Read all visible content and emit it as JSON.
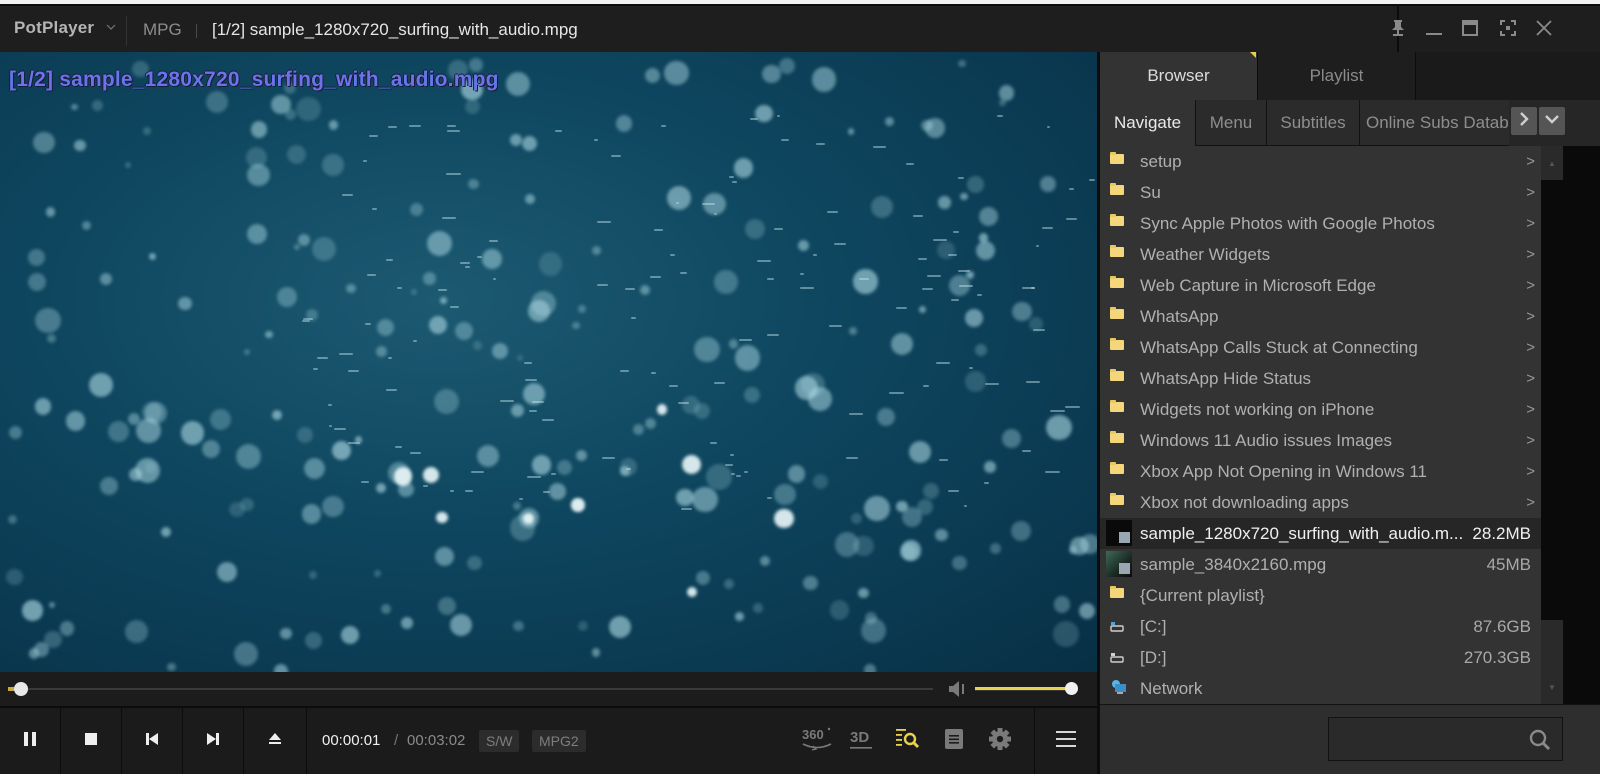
{
  "titlebar": {
    "app_name": "PotPlayer",
    "app_menu_chevron": "⌄",
    "format": "MPG",
    "title": "[1/2] sample_1280x720_surfing_with_audio.mpg",
    "window_buttons": [
      "pin-icon",
      "minimize-icon",
      "maximize-icon",
      "fullscreen-icon",
      "close-icon"
    ]
  },
  "video": {
    "osd_text": "[1/2] sample_1280x720_surfing_with_audio.mpg"
  },
  "playback": {
    "seek_progress_fraction": 0.005,
    "volume_fraction": 1.0,
    "current_time": "00:00:01",
    "time_separator": "/",
    "total_time": "00:03:02",
    "decoder_badge": "S/W",
    "codec_badge": "MPG2",
    "buttons": [
      "pause",
      "stop",
      "previous",
      "next",
      "eject"
    ],
    "right_icons": [
      "360-icon",
      "3d-icon",
      "playlist-search-icon",
      "document-icon",
      "gear-icon",
      "menu-icon"
    ],
    "label_360": "360°",
    "label_3d": "3D"
  },
  "panel": {
    "tabs": [
      {
        "label": "Browser",
        "active": true
      },
      {
        "label": "Playlist",
        "active": false
      }
    ],
    "subtabs": [
      {
        "label": "Navigate",
        "active": true
      },
      {
        "label": "Menu",
        "active": false
      },
      {
        "label": "Subtitles",
        "active": false
      },
      {
        "label": "Online Subs Datab",
        "active": false
      }
    ],
    "items": [
      {
        "type": "folder",
        "label": "setup",
        "chevron": ">"
      },
      {
        "type": "folder",
        "label": "Su",
        "chevron": ">"
      },
      {
        "type": "folder",
        "label": "Sync Apple Photos with Google Photos",
        "chevron": ">"
      },
      {
        "type": "folder",
        "label": "Weather Widgets",
        "chevron": ">"
      },
      {
        "type": "folder",
        "label": "Web Capture in Microsoft Edge",
        "chevron": ">"
      },
      {
        "type": "folder",
        "label": "WhatsApp",
        "chevron": ">"
      },
      {
        "type": "folder",
        "label": "WhatsApp Calls Stuck at Connecting",
        "chevron": ">"
      },
      {
        "type": "folder",
        "label": "WhatsApp Hide Status",
        "chevron": ">"
      },
      {
        "type": "folder",
        "label": "Widgets not working on iPhone",
        "chevron": ">"
      },
      {
        "type": "folder",
        "label": "Windows 11 Audio issues Images",
        "chevron": ">"
      },
      {
        "type": "folder",
        "label": "Xbox App Not Opening in Windows 11",
        "chevron": ">"
      },
      {
        "type": "folder",
        "label": "Xbox not downloading apps",
        "chevron": ">"
      },
      {
        "type": "video",
        "label": "sample_1280x720_surfing_with_audio.m...",
        "size": "28.2MB",
        "selected": true
      },
      {
        "type": "video",
        "label": "sample_3840x2160.mpg",
        "size": "45MB"
      },
      {
        "type": "folder",
        "label": "{Current playlist}"
      },
      {
        "type": "drive",
        "label": "[C:]",
        "size": "87.6GB"
      },
      {
        "type": "drive",
        "label": "[D:]",
        "size": "270.3GB"
      },
      {
        "type": "network",
        "label": "Network"
      }
    ],
    "search": {
      "value": "",
      "placeholder": ""
    }
  },
  "colors": {
    "accent_yellow": "#e8d24a",
    "osd_text": "#6a74e8",
    "folder": "#f3d77a",
    "background": "#1c1c1c",
    "panel": "#333333"
  }
}
